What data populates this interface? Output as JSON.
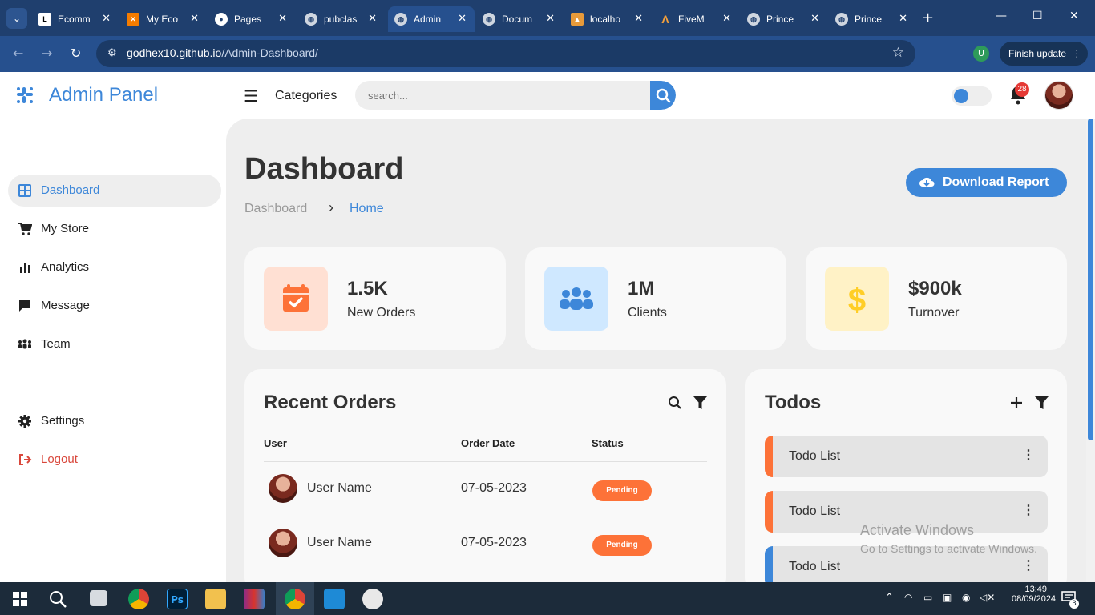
{
  "browser": {
    "tabs": [
      {
        "title": "Ecomm",
        "icon": "L"
      },
      {
        "title": "My Eco",
        "icon": "X"
      },
      {
        "title": "Pages",
        "icon": "gh"
      },
      {
        "title": "pubclas",
        "icon": "globe"
      },
      {
        "title": "Admin",
        "icon": "globe",
        "active": true
      },
      {
        "title": "Docum",
        "icon": "globe"
      },
      {
        "title": "localho",
        "icon": "ms"
      },
      {
        "title": "FiveM",
        "icon": "fivem"
      },
      {
        "title": "Prince",
        "icon": "globe"
      },
      {
        "title": "Prince",
        "icon": "globe"
      }
    ],
    "url_domain": "godhex10.github.io",
    "url_path": "/Admin-Dashboard/",
    "profile_initial": "U",
    "finish_update": "Finish update"
  },
  "header": {
    "brand": "Admin Panel",
    "categories": "Categories",
    "search_placeholder": "search...",
    "notification_count": "28"
  },
  "sidebar": {
    "items": [
      {
        "label": "Dashboard",
        "icon": "grid-icon",
        "active": true
      },
      {
        "label": "My Store",
        "icon": "cart-icon"
      },
      {
        "label": "Analytics",
        "icon": "bar-chart-icon"
      },
      {
        "label": "Message",
        "icon": "message-icon"
      },
      {
        "label": "Team",
        "icon": "team-icon"
      },
      {
        "label": "Settings",
        "icon": "gear-icon"
      },
      {
        "label": "Logout",
        "icon": "logout-icon"
      }
    ]
  },
  "main": {
    "title": "Dashboard",
    "breadcrumb": [
      "Dashboard",
      "Home"
    ],
    "download_label": "Download Report",
    "stats": [
      {
        "value": "1.5K",
        "label": "New Orders",
        "icon": "calendar-check-icon",
        "bg": "#ffe0d3",
        "color": "#fd7238"
      },
      {
        "value": "1M",
        "label": "Clients",
        "icon": "people-icon",
        "bg": "#cfe8ff",
        "color": "#3d87d9"
      },
      {
        "value": "$900k",
        "label": "Turnover",
        "icon": "dollar-icon",
        "bg": "#fff2c6",
        "color": "#ffce26"
      }
    ],
    "orders": {
      "title": "Recent Orders",
      "columns": [
        "User",
        "Order Date",
        "Status"
      ],
      "rows": [
        {
          "user": "User Name",
          "date": "07-05-2023",
          "status": "Pending"
        },
        {
          "user": "User Name",
          "date": "07-05-2023",
          "status": "Pending"
        }
      ]
    },
    "todos": {
      "title": "Todos",
      "items": [
        {
          "label": "Todo List",
          "color": "#fd7238"
        },
        {
          "label": "Todo List",
          "color": "#fd7238"
        },
        {
          "label": "Todo List",
          "color": "#3d87d9"
        }
      ]
    }
  },
  "watermark": {
    "line1": "Activate Windows",
    "line2": "Go to Settings to activate Windows."
  },
  "taskbar": {
    "time": "13:49",
    "date": "08/09/2024",
    "notifications": "3"
  }
}
